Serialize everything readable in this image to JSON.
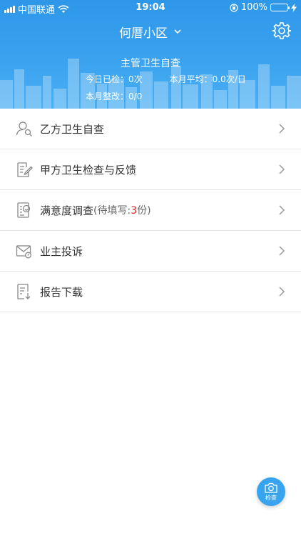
{
  "status_bar": {
    "carrier": "中国联通",
    "time": "19:04",
    "battery_percent": "100%",
    "battery_level": 1.0
  },
  "header": {
    "community_name": "何厝小区",
    "supervisor_title": "主管卫生自查",
    "today_checked_label": "今日已检：",
    "today_checked_value": "0次",
    "month_avg_label": "本月平均：",
    "month_avg_value": "0.0次/日",
    "month_rectify_label": "本月整改：",
    "month_rectify_value": "0/0"
  },
  "menu": {
    "items": [
      {
        "label": "乙方卫生自查",
        "icon": "user-search-icon"
      },
      {
        "label": "甲方卫生检查与反馈",
        "icon": "edit-note-icon"
      },
      {
        "label": "满意度调查",
        "pending_prefix": "(待填写:",
        "pending_count": "3",
        "pending_suffix": "份)",
        "icon": "survey-icon"
      },
      {
        "label": "业主投诉",
        "icon": "mail-complaint-icon"
      },
      {
        "label": "报告下载",
        "icon": "report-download-icon"
      }
    ]
  },
  "fab": {
    "label": "检查",
    "icon": "camera-icon"
  },
  "colors": {
    "header_blue": "#3aa2ef",
    "fab_blue": "#38a4ef",
    "pending_red": "#e02020",
    "battery_green": "#4cd964"
  }
}
